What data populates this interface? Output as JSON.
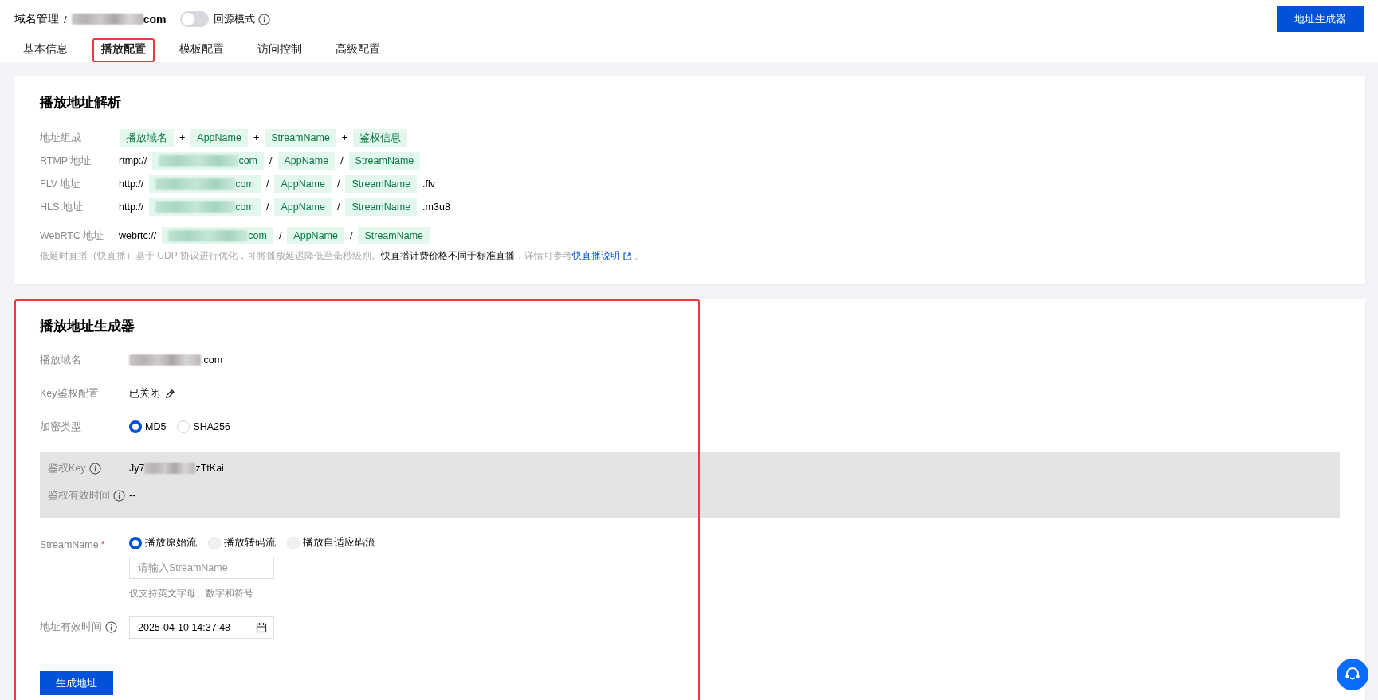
{
  "breadcrumb": {
    "parent": "域名管理",
    "separator": "/",
    "domain_tail": "com"
  },
  "origin_mode": {
    "label": "回源模式",
    "on": false
  },
  "top_button": "地址生成器",
  "tabs": [
    {
      "label": "基本信息",
      "selected": false,
      "highlighted": false
    },
    {
      "label": "播放配置",
      "selected": true,
      "highlighted": true
    },
    {
      "label": "模板配置",
      "selected": false,
      "highlighted": false
    },
    {
      "label": "访问控制",
      "selected": false,
      "highlighted": false
    },
    {
      "label": "高级配置",
      "selected": false,
      "highlighted": false
    }
  ],
  "resolve_card": {
    "title": "播放地址解析",
    "rows": [
      {
        "label": "地址组成",
        "parts": [
          {
            "kind": "chip",
            "text": "播放域名"
          },
          {
            "kind": "plain",
            "text": "+"
          },
          {
            "kind": "chip",
            "text": "AppName"
          },
          {
            "kind": "plain",
            "text": "+"
          },
          {
            "kind": "chip",
            "text": "StreamName"
          },
          {
            "kind": "plain",
            "text": "+"
          },
          {
            "kind": "chip",
            "text": "鉴权信息"
          }
        ]
      },
      {
        "label": "RTMP 地址",
        "parts": [
          {
            "kind": "plain",
            "text": "rtmp://"
          },
          {
            "kind": "redacted",
            "text": "com"
          },
          {
            "kind": "plain",
            "text": "/"
          },
          {
            "kind": "chip",
            "text": "AppName"
          },
          {
            "kind": "plain",
            "text": "/"
          },
          {
            "kind": "chip",
            "text": "StreamName"
          }
        ]
      },
      {
        "label": "FLV 地址",
        "parts": [
          {
            "kind": "plain",
            "text": "http://"
          },
          {
            "kind": "redacted",
            "text": "com"
          },
          {
            "kind": "plain",
            "text": "/"
          },
          {
            "kind": "chip",
            "text": "AppName"
          },
          {
            "kind": "plain",
            "text": "/"
          },
          {
            "kind": "chip",
            "text": "StreamName"
          },
          {
            "kind": "plain",
            "text": ".flv"
          }
        ]
      },
      {
        "label": "HLS 地址",
        "parts": [
          {
            "kind": "plain",
            "text": "http://"
          },
          {
            "kind": "redacted",
            "text": "com"
          },
          {
            "kind": "plain",
            "text": "/"
          },
          {
            "kind": "chip",
            "text": "AppName"
          },
          {
            "kind": "plain",
            "text": "/"
          },
          {
            "kind": "chip",
            "text": "StreamName"
          },
          {
            "kind": "plain",
            "text": ".m3u8"
          }
        ]
      },
      {
        "label": "WebRTC 地址",
        "parts": [
          {
            "kind": "plain",
            "text": "webrtc://"
          },
          {
            "kind": "redacted",
            "text": "com"
          },
          {
            "kind": "plain",
            "text": "/"
          },
          {
            "kind": "chip",
            "text": "AppName"
          },
          {
            "kind": "plain",
            "text": "/"
          },
          {
            "kind": "chip",
            "text": "StreamName"
          }
        ]
      }
    ],
    "note": {
      "text": "低延时直播（快直播）基于 UDP 协议进行优化，可将播放延迟降低至毫秒级别。**快直播计费价格不同于标准直播**，详情可参考",
      "link": "快直播说明",
      "end": "。"
    }
  },
  "generator": {
    "title": "播放地址生成器",
    "highlighted": true,
    "domain": {
      "label": "播放域名",
      "value_tail": ".com"
    },
    "key_auth": {
      "label": "Key鉴权配置",
      "value": "已关闭"
    },
    "encryption": {
      "label": "加密类型",
      "options": [
        {
          "label": "MD5",
          "selected": true,
          "disabled": false
        },
        {
          "label": "SHA256",
          "selected": false,
          "disabled": false
        }
      ]
    },
    "auth_panel": {
      "key": {
        "label": "鉴权Key",
        "value_head": "Jy7",
        "value_tail": "zTtKai"
      },
      "validity": {
        "label": "鉴权有效时间",
        "value": "--"
      }
    },
    "stream_name": {
      "label": "StreamName",
      "required_mark": "*",
      "options": [
        {
          "label": "播放原始流",
          "selected": true,
          "disabled": false
        },
        {
          "label": "播放转码流",
          "selected": false,
          "disabled": true
        },
        {
          "label": "播放自适应码流",
          "selected": false,
          "disabled": true
        }
      ],
      "placeholder": "请输入StreamName",
      "hint": "仅支持英文字母、数字和符号"
    },
    "expiry": {
      "label": "地址有效时间",
      "value": "2025-04-10 14:37:48"
    },
    "submit": "生成地址"
  }
}
